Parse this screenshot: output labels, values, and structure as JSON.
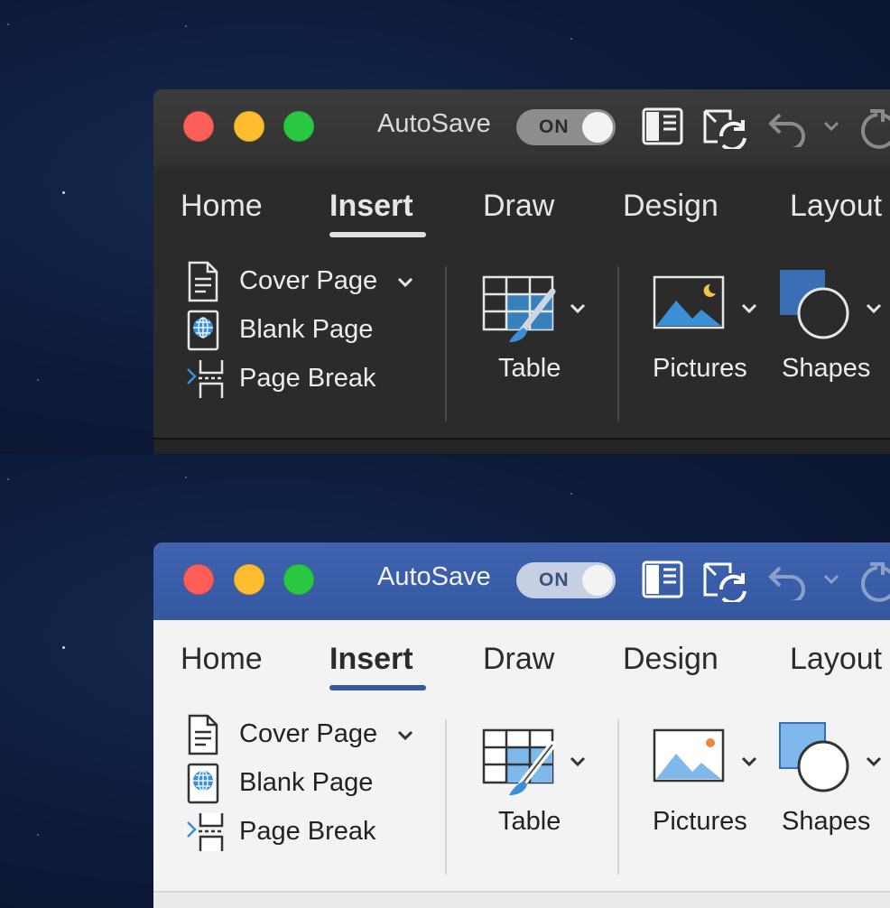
{
  "panels": [
    {
      "theme": "dark",
      "titlebar": {
        "autosave_label": "AutoSave",
        "autosave_state": "ON"
      },
      "tabs": [
        "Home",
        "Insert",
        "Draw",
        "Design",
        "Layout"
      ],
      "active_tab": "Insert",
      "pages_group": {
        "cover_page": "Cover Page",
        "blank_page": "Blank Page",
        "page_break": "Page Break"
      },
      "table_label": "Table",
      "pictures_label": "Pictures",
      "shapes_label": "Shapes",
      "colors": {
        "titlebar": "#353535",
        "ribbon": "#2b2b2b",
        "text": "#e6e6e6"
      }
    },
    {
      "theme": "light",
      "titlebar": {
        "autosave_label": "AutoSave",
        "autosave_state": "ON"
      },
      "tabs": [
        "Home",
        "Insert",
        "Draw",
        "Design",
        "Layout"
      ],
      "active_tab": "Insert",
      "pages_group": {
        "cover_page": "Cover Page",
        "blank_page": "Blank Page",
        "page_break": "Page Break"
      },
      "table_label": "Table",
      "pictures_label": "Pictures",
      "shapes_label": "Shapes",
      "colors": {
        "titlebar": "#3558a3",
        "ribbon": "#f3f3f3",
        "text": "#2b2b2b"
      }
    }
  ],
  "icons": [
    "close-icon",
    "minimize-icon",
    "zoom-icon",
    "sidebar-toggle-icon",
    "sync-icon",
    "undo-icon",
    "redo-icon",
    "cover-page-icon",
    "blank-page-icon",
    "page-break-icon",
    "table-icon",
    "pictures-icon",
    "shapes-icon",
    "chevron-down-icon"
  ]
}
